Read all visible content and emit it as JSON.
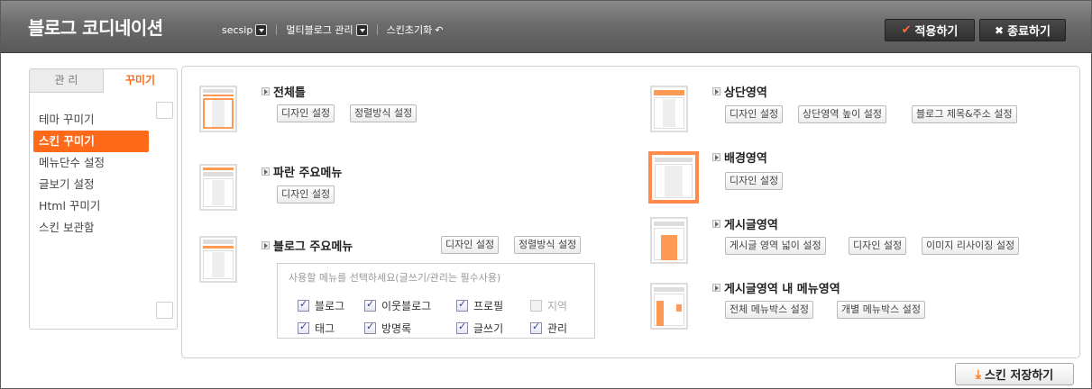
{
  "app": {
    "title": "블로그 코디네이션"
  },
  "topnav": {
    "blog_id": "secsip",
    "multiblog": "멀티블로그 관리",
    "skin_reset": "스킨초기화"
  },
  "actions": {
    "apply": "적용하기",
    "exit": "종료하기",
    "save_skin": "스킨 저장하기"
  },
  "left": {
    "tabs": [
      "관 리",
      "꾸미기"
    ],
    "menu": [
      "테마 꾸미기",
      "스킨 꾸미기",
      "메뉴단수 설정",
      "글보기 설정",
      "Html 꾸미기",
      "스킨 보관함"
    ],
    "active_index": 1
  },
  "sections": {
    "whole_frame": {
      "title": "전체틀",
      "buttons": [
        "디자인 설정",
        "정렬방식 설정"
      ]
    },
    "blue_menu": {
      "title": "파란 주요메뉴",
      "buttons": [
        "디자인 설정"
      ]
    },
    "blog_menu": {
      "title": "블로그 주요메뉴",
      "buttons": [
        "디자인 설정",
        "정렬방식 설정"
      ],
      "hint": "사용할 메뉴를 선택하세요(글쓰기/관리는 필수사용)",
      "options": [
        {
          "label": "블로그",
          "checked": true,
          "enabled": true
        },
        {
          "label": "이웃블로그",
          "checked": true,
          "enabled": true
        },
        {
          "label": "프로필",
          "checked": true,
          "enabled": true
        },
        {
          "label": "지역",
          "checked": false,
          "enabled": false
        },
        {
          "label": "태그",
          "checked": true,
          "enabled": true
        },
        {
          "label": "방명록",
          "checked": true,
          "enabled": true
        },
        {
          "label": "글쓰기",
          "checked": true,
          "enabled": true
        },
        {
          "label": "관리",
          "checked": true,
          "enabled": true
        }
      ]
    },
    "top_area": {
      "title": "상단영역",
      "buttons": [
        "디자인 설정",
        "상단영역 높이 설정",
        "블로그 제목&주소 설정"
      ]
    },
    "background": {
      "title": "배경영역",
      "buttons": [
        "디자인 설정"
      ]
    },
    "post_area": {
      "title": "게시글영역",
      "buttons": [
        "게시글 영역 넓이 설정",
        "디자인 설정",
        "이미지 리사이징 설정"
      ]
    },
    "post_menu_area": {
      "title": "게시글영역 내 메뉴영역",
      "buttons": [
        "전체 메뉴박스 설정",
        "개별 메뉴박스 설정"
      ]
    }
  },
  "colors": {
    "accent": "#ff6a1a",
    "topbar": "#6b6b6b",
    "thumb_orange": "#ff9a55"
  },
  "icons": {
    "check": "check-icon",
    "close": "close-icon",
    "reset": "reset-icon",
    "save": "download-icon",
    "dropdown": "dropdown-arrow-icon"
  }
}
